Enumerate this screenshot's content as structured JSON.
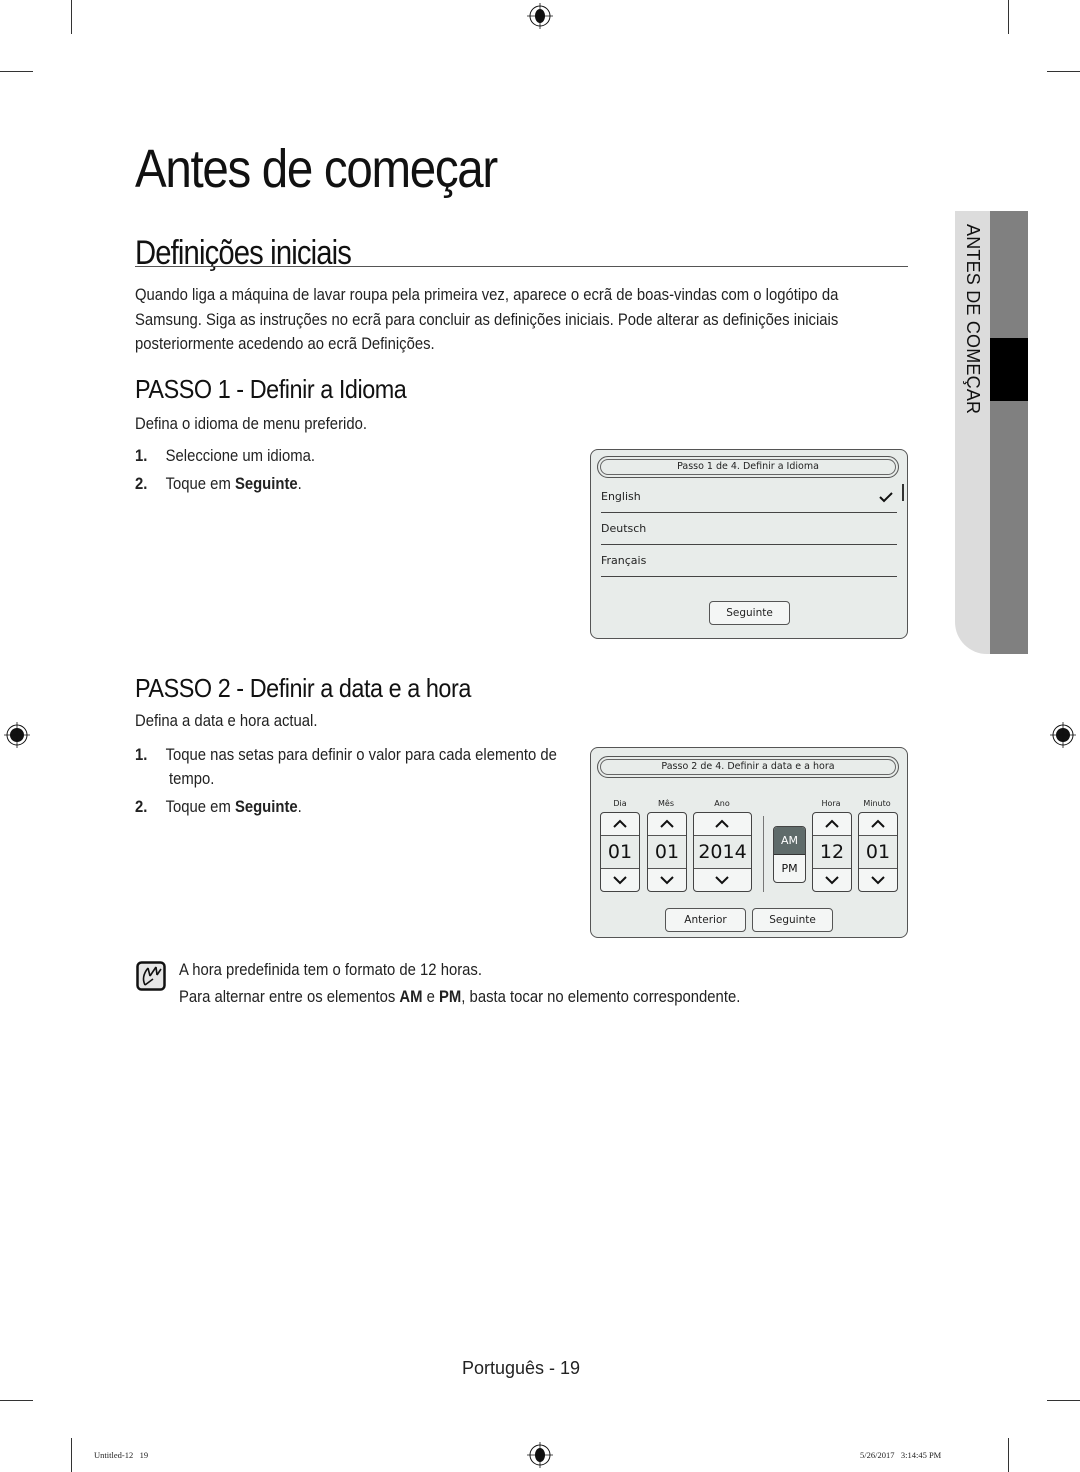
{
  "page": {
    "title": "Antes de começar",
    "section_title": "Definições iniciais",
    "intro": "Quando liga a máquina de lavar roupa pela primeira vez, aparece o ecrã de boas-vindas com o logótipo da Samsung. Siga as instruções no ecrã para concluir as definições iniciais. Pode alterar as definições iniciais posteriormente acedendo ao ecrã Definições.",
    "side_tab": "ANTES DE COMEÇAR"
  },
  "step1": {
    "heading": "PASSO 1 - Definir a Idioma",
    "description": "Defina o idioma de menu preferido.",
    "items": [
      {
        "num": "1.",
        "text": "Seleccione um idioma.",
        "bold": ""
      },
      {
        "num": "2.",
        "text": "Toque em ",
        "bold": "Seguinte",
        "suffix": "."
      }
    ],
    "screen": {
      "header": "Passo 1 de 4. Definir a Idioma",
      "languages": [
        {
          "label": "English",
          "selected": true
        },
        {
          "label": "Deutsch",
          "selected": false
        },
        {
          "label": "Français",
          "selected": false
        }
      ],
      "next_button": "Seguinte"
    }
  },
  "step2": {
    "heading": "PASSO 2 - Definir a data e a hora",
    "description": "Defina a data e hora actual.",
    "items": [
      {
        "num": "1.",
        "text": "Toque nas setas para definir o valor para cada elemento de",
        "text2": "tempo."
      },
      {
        "num": "2.",
        "text": "Toque em ",
        "bold": "Seguinte",
        "suffix": "."
      }
    ],
    "screen": {
      "header": "Passo 2 de 4. Definir a data e a hora",
      "fields": [
        {
          "label": "Dia",
          "value": "01"
        },
        {
          "label": "Mês",
          "value": "01"
        },
        {
          "label": "Ano",
          "value": "2014"
        },
        {
          "label": "Hora",
          "value": "12"
        },
        {
          "label": "Minuto",
          "value": "01"
        }
      ],
      "am_label": "AM",
      "pm_label": "PM",
      "am_pm_selected": "AM",
      "prev_button": "Anterior",
      "next_button": "Seguinte"
    }
  },
  "note": {
    "line1": "A hora predefinida tem o formato de 12 horas.",
    "line2_a": "Para alternar entre os elementos ",
    "line2_am": "AM",
    "line2_e": " e ",
    "line2_pm": "PM",
    "line2_b": ", basta tocar no elemento correspondente."
  },
  "footer": {
    "page_label": "Português - 19",
    "file_info": "Untitled-12   19",
    "timestamp": "5/26/2017   3:14:45 PM"
  },
  "colors": {
    "panel_bg": "#e8ecea",
    "am_selected_bg": "#5f6b6a",
    "tab_gray": "#808080",
    "tab_light": "#dcdcdc"
  }
}
